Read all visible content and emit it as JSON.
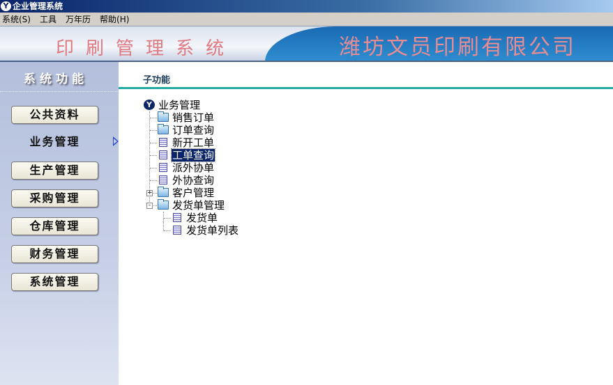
{
  "window": {
    "title": "企业管理系统",
    "logo": "Y"
  },
  "menu": [
    "系统(S)",
    "工具",
    "万年历",
    "帮助(H)"
  ],
  "banner": {
    "system_name": "印刷管理系统",
    "company": "潍坊文员印刷有限公司"
  },
  "sidebar": {
    "title": "系统功能",
    "items": [
      {
        "label": "公共资料",
        "active": false
      },
      {
        "label": "业务管理",
        "active": true
      },
      {
        "label": "生产管理",
        "active": false
      },
      {
        "label": "采购管理",
        "active": false
      },
      {
        "label": "仓库管理",
        "active": false
      },
      {
        "label": "财务管理",
        "active": false
      },
      {
        "label": "系统管理",
        "active": false
      }
    ]
  },
  "panel": {
    "title": "子功能"
  },
  "tree": {
    "root": "业务管理",
    "children": [
      {
        "label": "销售订单",
        "icon": "folder-icon"
      },
      {
        "label": "订单查询",
        "icon": "folder-icon"
      },
      {
        "label": "新开工单",
        "icon": "document-icon"
      },
      {
        "label": "工单查询",
        "icon": "document-icon",
        "selected": true
      },
      {
        "label": "派外协单",
        "icon": "document-icon"
      },
      {
        "label": "外协查询",
        "icon": "document-icon"
      },
      {
        "label": "客户管理",
        "icon": "folder-icon",
        "expander": "+"
      },
      {
        "label": "发货单管理",
        "icon": "folder-open-icon",
        "expander": "-",
        "children": [
          {
            "label": "发货单",
            "icon": "document-icon"
          },
          {
            "label": "发货单列表",
            "icon": "document-icon"
          }
        ]
      }
    ]
  }
}
